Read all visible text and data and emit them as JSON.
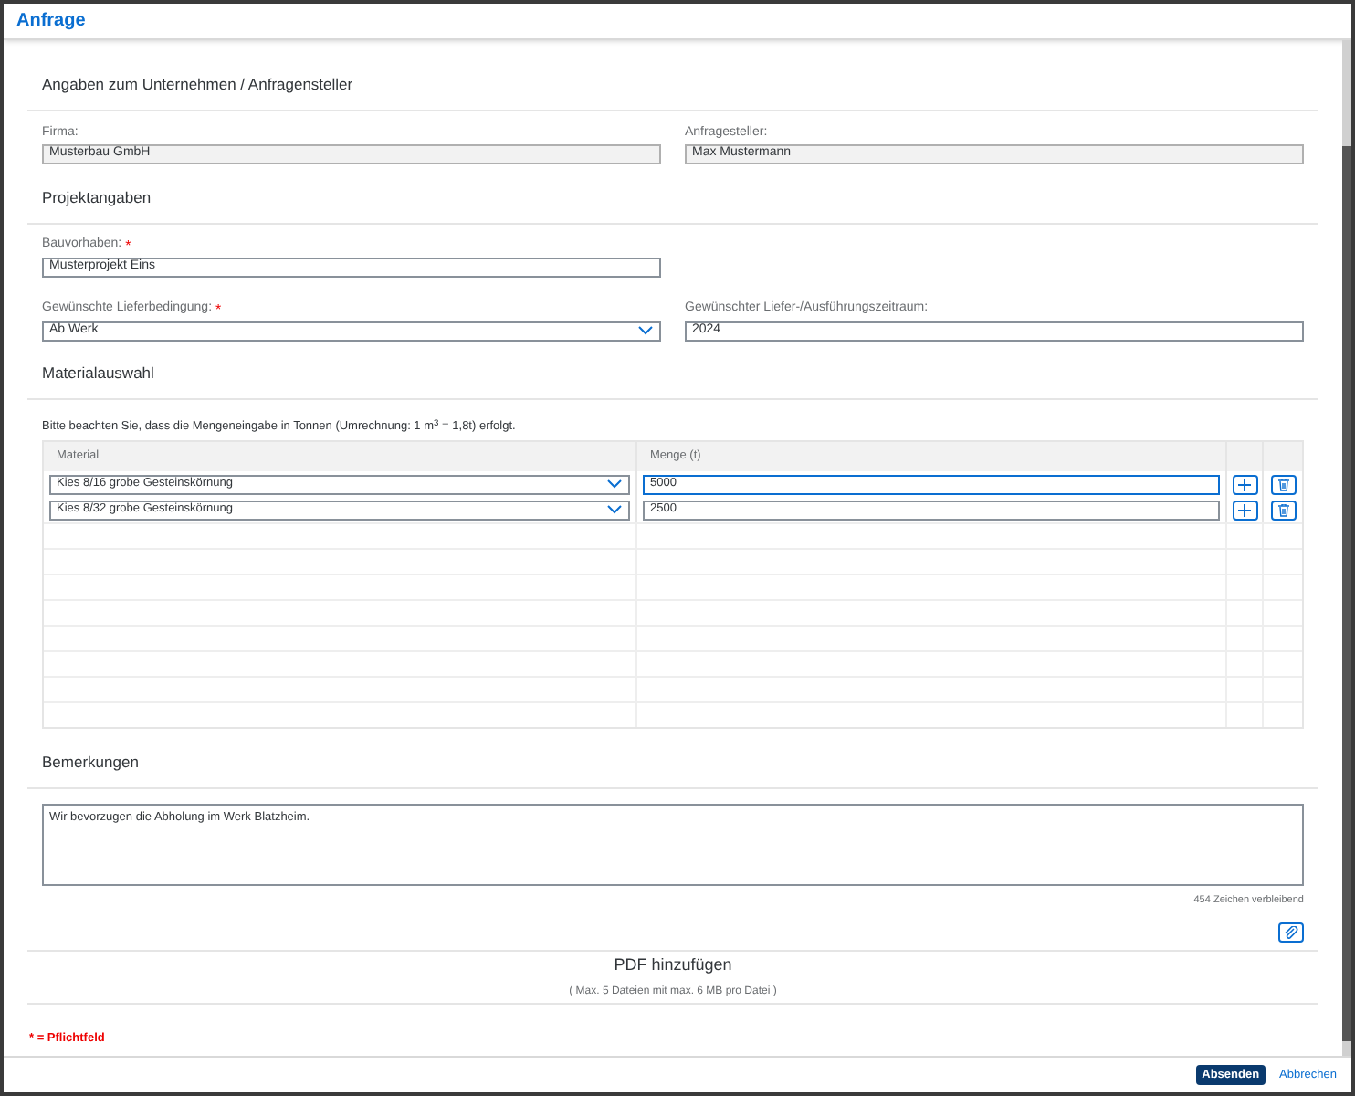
{
  "dialog": {
    "title": "Anfrage"
  },
  "sections": [
    {
      "heading": "Angaben zum Unternehmen / Anfragensteller",
      "fields": [
        {
          "label": "Firma:",
          "value": "Musterbau GmbH",
          "required": false,
          "kind": "readonly"
        },
        {
          "label": "Anfragesteller:",
          "value": "Max Mustermann",
          "required": false,
          "kind": "readonly"
        }
      ]
    },
    {
      "heading": "Projektangaben",
      "fields": [
        {
          "label": "Bauvorhaben:",
          "value": "Musterprojekt Eins",
          "required": true,
          "kind": "input"
        },
        {
          "label": "Gewünschte Lieferbedingung:",
          "value": "Ab Werk",
          "required": true,
          "kind": "select"
        },
        {
          "label": "Gewünschter Liefer-/Ausführungszeitraum:",
          "value": "2024",
          "required": false,
          "kind": "input"
        }
      ]
    }
  ],
  "material": {
    "heading": "Materialauswahl",
    "note": "Bitte beachten Sie, dass die Mengeneingabe in Tonnen (Umrechnung: 1 m$^{3}$ = 1,8t) erfolgt.",
    "columns": [
      "Material",
      "Menge (t)"
    ],
    "rows": [
      {
        "material": "Kies 8/16 grobe Gesteinskörnung",
        "quantity": "5000",
        "focused": true
      },
      {
        "material": "Kies 8/32 grobe Gesteinskörnung",
        "quantity": "2500",
        "focused": false
      }
    ]
  },
  "remarks": {
    "heading": "Bemerkungen",
    "value": "Wir bevorzugen die Abholung im Werk Blatzheim.",
    "counter": "454 Zeichen verbleibend"
  },
  "upload": {
    "title": "PDF hinzufügen",
    "hint": "( Max. 5 Dateien mit max. 6 MB pro Datei )"
  },
  "required_marker": "*",
  "required_note": "* = Pflichtfeld",
  "buttons": [
    "Absenden",
    "Abbrechen"
  ]
}
